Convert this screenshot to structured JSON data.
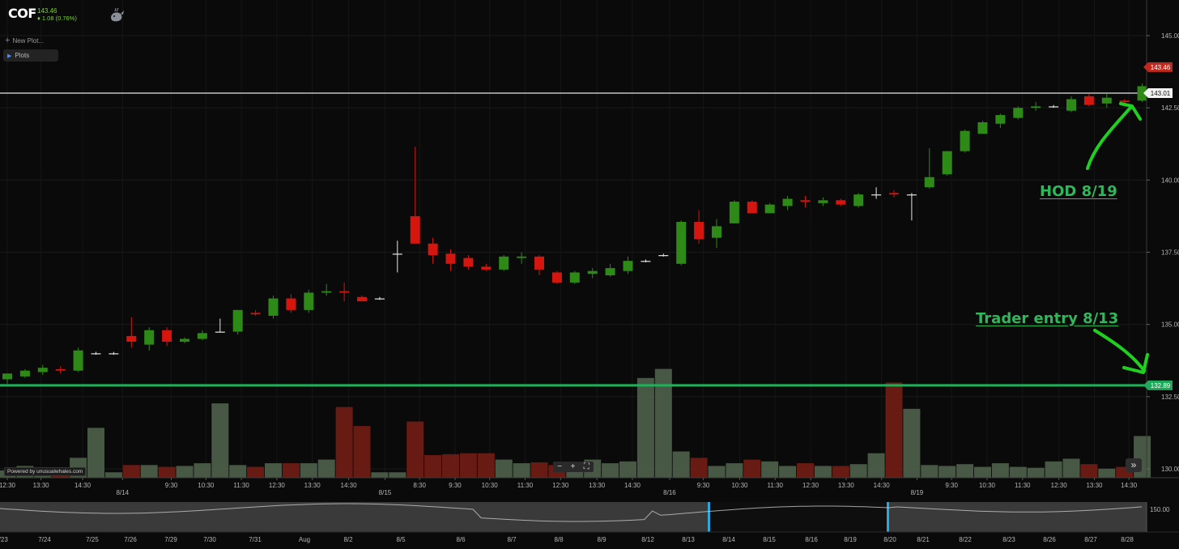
{
  "header": {
    "ticker": "COF",
    "price": "143.46",
    "change": "♦ 1.08 (0.76%)",
    "new_plot_label": "New Plot...",
    "plots_label": "Plots"
  },
  "toolbar": {
    "zoom_out": "−",
    "zoom_in": "+",
    "fit": "⛶",
    "forward": "»"
  },
  "footer": {
    "powered_by": "Powered by unusualwhales.com"
  },
  "annotations": {
    "hod": "HOD 8/19",
    "entry": "Trader entry 8/13"
  },
  "colors": {
    "up": "#2e8a17",
    "down": "#d4160f",
    "vol_up": "#4b5e48",
    "vol_down": "#6e1c14",
    "entry_line": "#1fb15a",
    "hod_line": "#e8e8e8",
    "annot": "#2fb85a"
  },
  "chart_data": {
    "type": "candlestick",
    "y_ticks": [
      "145.00",
      "142.50",
      "140.00",
      "137.50",
      "135.00",
      "132.50",
      "130.00"
    ],
    "ylim": [
      129.7,
      146.2
    ],
    "price_badges": [
      {
        "label": "143.46",
        "value": 143.46,
        "style": "last"
      },
      {
        "label": "143.01",
        "value": 143.01,
        "style": "hline"
      },
      {
        "label": "132.89",
        "value": 132.89,
        "style": "entry"
      }
    ],
    "x_ticks": [
      "12:30",
      "13:30",
      "14:30",
      "8/14",
      "9:30",
      "10:30",
      "11:30",
      "12:30",
      "13:30",
      "14:30",
      "8/15",
      "8:30",
      "9:30",
      "10:30",
      "11:30",
      "12:30",
      "13:30",
      "14:30",
      "8/16",
      "9:30",
      "10:30",
      "11:30",
      "12:30",
      "13:30",
      "14:30",
      "8/19",
      "9:30",
      "10:30",
      "11:30",
      "12:30",
      "13:30",
      "14:30"
    ],
    "candles": [
      {
        "o": 133.1,
        "h": 133.3,
        "l": 132.95,
        "c": 133.3
      },
      {
        "o": 133.2,
        "h": 133.45,
        "l": 133.15,
        "c": 133.4
      },
      {
        "o": 133.35,
        "h": 133.6,
        "l": 133.25,
        "c": 133.5
      },
      {
        "o": 133.45,
        "h": 133.55,
        "l": 133.3,
        "c": 133.4
      },
      {
        "o": 133.4,
        "h": 134.2,
        "l": 133.35,
        "c": 134.1
      },
      {
        "o": 134.0,
        "h": 134.05,
        "l": 133.95,
        "c": 134.0
      },
      {
        "o": 134.0,
        "h": 134.05,
        "l": 133.95,
        "c": 134.0
      },
      {
        "o": 134.6,
        "h": 135.25,
        "l": 134.2,
        "c": 134.4
      },
      {
        "o": 134.3,
        "h": 134.9,
        "l": 134.1,
        "c": 134.8
      },
      {
        "o": 134.8,
        "h": 134.9,
        "l": 134.25,
        "c": 134.4
      },
      {
        "o": 134.4,
        "h": 134.55,
        "l": 134.35,
        "c": 134.5
      },
      {
        "o": 134.5,
        "h": 134.8,
        "l": 134.45,
        "c": 134.7
      },
      {
        "o": 134.75,
        "h": 135.2,
        "l": 134.75,
        "c": 134.75
      },
      {
        "o": 134.75,
        "h": 135.5,
        "l": 134.65,
        "c": 135.5
      },
      {
        "o": 135.4,
        "h": 135.5,
        "l": 135.3,
        "c": 135.35
      },
      {
        "o": 135.3,
        "h": 136.0,
        "l": 135.2,
        "c": 135.9
      },
      {
        "o": 135.9,
        "h": 136.05,
        "l": 135.4,
        "c": 135.5
      },
      {
        "o": 135.5,
        "h": 136.2,
        "l": 135.4,
        "c": 136.1
      },
      {
        "o": 136.1,
        "h": 136.4,
        "l": 136.0,
        "c": 136.15
      },
      {
        "o": 136.15,
        "h": 136.45,
        "l": 135.8,
        "c": 136.1
      },
      {
        "o": 135.95,
        "h": 136.0,
        "l": 135.8,
        "c": 135.8
      },
      {
        "o": 135.9,
        "h": 135.95,
        "l": 135.85,
        "c": 135.9
      },
      {
        "o": 137.45,
        "h": 137.9,
        "l": 136.8,
        "c": 137.45
      },
      {
        "o": 138.75,
        "h": 141.15,
        "l": 137.8,
        "c": 137.8
      },
      {
        "o": 137.8,
        "h": 138.0,
        "l": 137.1,
        "c": 137.4
      },
      {
        "o": 137.45,
        "h": 137.6,
        "l": 136.85,
        "c": 137.1
      },
      {
        "o": 137.3,
        "h": 137.4,
        "l": 136.9,
        "c": 137.0
      },
      {
        "o": 137.0,
        "h": 137.1,
        "l": 136.85,
        "c": 136.9
      },
      {
        "o": 136.9,
        "h": 137.4,
        "l": 136.85,
        "c": 137.35
      },
      {
        "o": 137.3,
        "h": 137.5,
        "l": 137.1,
        "c": 137.35
      },
      {
        "o": 137.35,
        "h": 137.4,
        "l": 136.7,
        "c": 136.9
      },
      {
        "o": 136.8,
        "h": 136.85,
        "l": 136.4,
        "c": 136.45
      },
      {
        "o": 136.45,
        "h": 136.85,
        "l": 136.4,
        "c": 136.8
      },
      {
        "o": 136.75,
        "h": 136.95,
        "l": 136.6,
        "c": 136.85
      },
      {
        "o": 136.7,
        "h": 137.1,
        "l": 136.65,
        "c": 136.95
      },
      {
        "o": 136.85,
        "h": 137.35,
        "l": 136.75,
        "c": 137.2
      },
      {
        "o": 137.2,
        "h": 137.25,
        "l": 137.15,
        "c": 137.2
      },
      {
        "o": 137.4,
        "h": 137.45,
        "l": 137.35,
        "c": 137.4
      },
      {
        "o": 137.1,
        "h": 138.6,
        "l": 137.05,
        "c": 138.55
      },
      {
        "o": 138.55,
        "h": 138.95,
        "l": 137.8,
        "c": 137.95
      },
      {
        "o": 138.0,
        "h": 138.65,
        "l": 137.65,
        "c": 138.4
      },
      {
        "o": 138.5,
        "h": 139.3,
        "l": 138.5,
        "c": 139.25
      },
      {
        "o": 139.25,
        "h": 139.3,
        "l": 138.85,
        "c": 138.85
      },
      {
        "o": 138.85,
        "h": 139.2,
        "l": 138.85,
        "c": 139.15
      },
      {
        "o": 139.1,
        "h": 139.45,
        "l": 138.95,
        "c": 139.35
      },
      {
        "o": 139.3,
        "h": 139.45,
        "l": 139.05,
        "c": 139.25
      },
      {
        "o": 139.2,
        "h": 139.4,
        "l": 139.1,
        "c": 139.3
      },
      {
        "o": 139.3,
        "h": 139.35,
        "l": 139.1,
        "c": 139.15
      },
      {
        "o": 139.1,
        "h": 139.55,
        "l": 139.05,
        "c": 139.5
      },
      {
        "o": 139.5,
        "h": 139.75,
        "l": 139.35,
        "c": 139.5
      },
      {
        "o": 139.55,
        "h": 139.65,
        "l": 139.4,
        "c": 139.5
      },
      {
        "o": 139.5,
        "h": 139.55,
        "l": 138.6,
        "c": 139.5
      },
      {
        "o": 139.75,
        "h": 141.1,
        "l": 139.7,
        "c": 140.1
      },
      {
        "o": 140.2,
        "h": 141.0,
        "l": 140.15,
        "c": 141.0
      },
      {
        "o": 141.0,
        "h": 141.75,
        "l": 140.95,
        "c": 141.7
      },
      {
        "o": 141.6,
        "h": 142.05,
        "l": 141.6,
        "c": 142.0
      },
      {
        "o": 141.95,
        "h": 142.3,
        "l": 141.8,
        "c": 142.25
      },
      {
        "o": 142.15,
        "h": 142.55,
        "l": 142.1,
        "c": 142.5
      },
      {
        "o": 142.5,
        "h": 142.7,
        "l": 142.4,
        "c": 142.55
      },
      {
        "o": 142.55,
        "h": 142.6,
        "l": 142.5,
        "c": 142.55
      },
      {
        "o": 142.4,
        "h": 142.9,
        "l": 142.35,
        "c": 142.8
      },
      {
        "o": 142.9,
        "h": 143.0,
        "l": 142.55,
        "c": 142.6
      },
      {
        "o": 142.65,
        "h": 143.0,
        "l": 142.5,
        "c": 142.85
      },
      {
        "o": 142.75,
        "h": 142.8,
        "l": 142.65,
        "c": 142.7
      },
      {
        "o": 142.75,
        "h": 143.35,
        "l": 142.7,
        "c": 143.25
      }
    ],
    "volume_levels": [
      0.08,
      0.13,
      0.1,
      0.06,
      0.22,
      0.55,
      0.06,
      0.14,
      0.14,
      0.12,
      0.13,
      0.16,
      0.82,
      0.14,
      0.12,
      0.16,
      0.16,
      0.16,
      0.2,
      0.78,
      0.57,
      0.06,
      0.06,
      0.62,
      0.25,
      0.26,
      0.27,
      0.27,
      0.2,
      0.16,
      0.17,
      0.14,
      0.12,
      0.2,
      0.16,
      0.18,
      1.1,
      1.2,
      0.29,
      0.22,
      0.13,
      0.16,
      0.2,
      0.18,
      0.13,
      0.16,
      0.13,
      0.13,
      0.15,
      0.27,
      1.05,
      0.76,
      0.14,
      0.13,
      0.15,
      0.12,
      0.16,
      0.12,
      0.11,
      0.18,
      0.21,
      0.15,
      0.1,
      0.12,
      0.46,
      0.6
    ],
    "navigator": {
      "date_labels": [
        "7/23",
        "7/24",
        "7/25",
        "7/26",
        "7/29",
        "7/30",
        "7/31",
        "Aug",
        "8/2",
        "8/5",
        "8/6",
        "8/7",
        "8/8",
        "8/9",
        "8/12",
        "8/13",
        "8/14",
        "8/15",
        "8/16",
        "8/19",
        "8/20",
        "8/21",
        "8/22",
        "8/23",
        "8/26",
        "8/27",
        "8/28"
      ],
      "y_tick": "150.00"
    }
  }
}
